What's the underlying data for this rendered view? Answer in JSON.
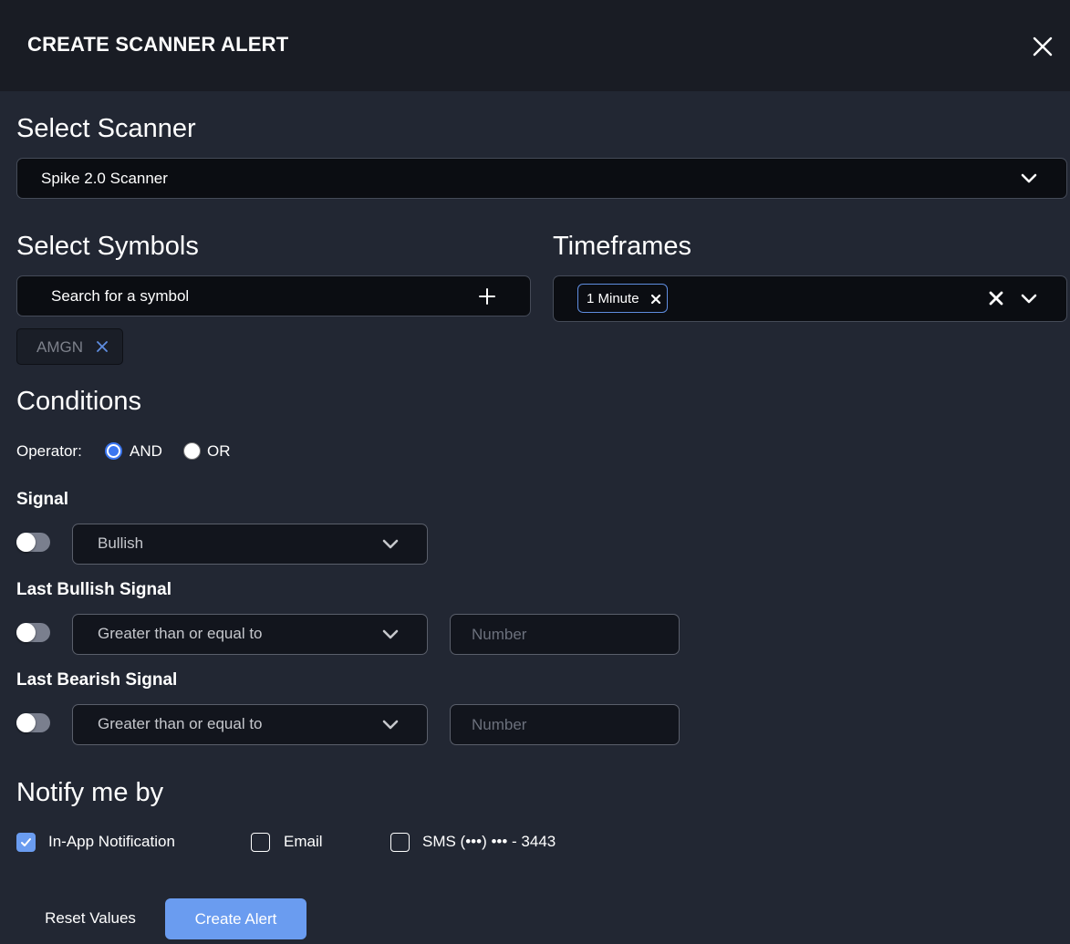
{
  "header": {
    "title": "CREATE SCANNER ALERT",
    "close_icon": "close-icon"
  },
  "scanner": {
    "title": "Select Scanner",
    "selected": "Spike 2.0 Scanner"
  },
  "symbols": {
    "title": "Select Symbols",
    "search_placeholder": "Search for a symbol",
    "add_icon": "plus-icon",
    "selected_chips": [
      {
        "label": "AMGN"
      }
    ]
  },
  "timeframes": {
    "title": "Timeframes",
    "selected_chips": [
      {
        "label": "1 Minute"
      }
    ]
  },
  "conditions": {
    "title": "Conditions",
    "operator_label": "Operator:",
    "operators": [
      {
        "label": "AND",
        "checked": true
      },
      {
        "label": "OR",
        "checked": false
      }
    ],
    "rows": [
      {
        "label": "Signal",
        "enabled": false,
        "select_value": "Bullish"
      },
      {
        "label": "Last Bullish Signal",
        "enabled": false,
        "select_value": "Greater than or equal to",
        "number_placeholder": "Number"
      },
      {
        "label": "Last Bearish Signal",
        "enabled": false,
        "select_value": "Greater than or equal to",
        "number_placeholder": "Number"
      }
    ]
  },
  "notify": {
    "title": "Notify me by",
    "options": [
      {
        "label": "In-App Notification",
        "checked": true
      },
      {
        "label": "Email",
        "checked": false
      },
      {
        "label": "SMS (•••) ••• - 3443",
        "checked": false
      }
    ]
  },
  "actions": {
    "reset_label": "Reset Values",
    "create_label": "Create Alert"
  },
  "colors": {
    "accent": "#6a9cf0",
    "radio_checked": "#3b76f0",
    "header_bg": "#191c24",
    "body_bg": "#222733"
  }
}
